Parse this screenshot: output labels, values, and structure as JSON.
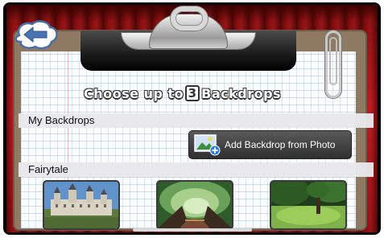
{
  "header": {
    "back_icon": "back-arrow-icon",
    "title_prefix": "Choose up to",
    "title_count": "3",
    "title_suffix": "Backdrops"
  },
  "sections": {
    "my_backdrops": {
      "label": "My Backdrops",
      "add_button_label": "Add Backdrop from Photo",
      "add_button_icon": "add-photo-icon"
    },
    "fairytale": {
      "label": "Fairytale",
      "thumbnails": [
        "castle",
        "tree-tunnel",
        "meadow-tree"
      ]
    }
  },
  "colors": {
    "curtain": "#b5141a",
    "board": "#8e7a63",
    "button_bg": "#3a3a3a",
    "header_bar": "#e8e8ec"
  }
}
